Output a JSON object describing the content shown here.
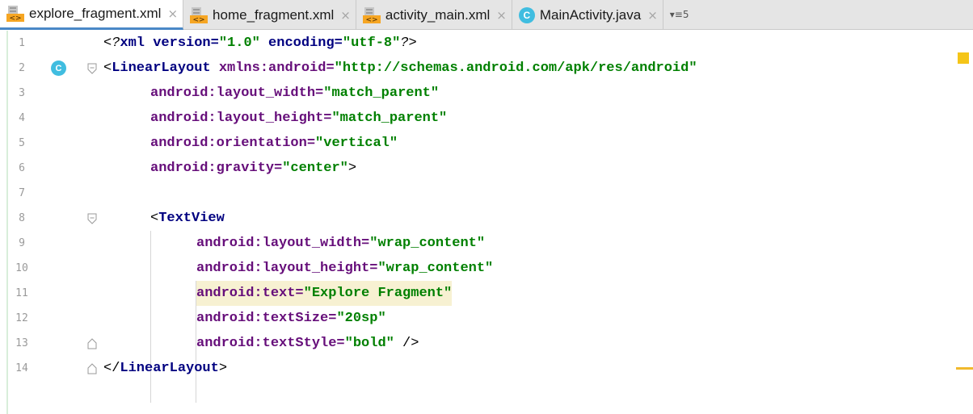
{
  "tabs": [
    {
      "label": "explore_fragment.xml",
      "icon": "xml-file-icon",
      "active": true,
      "close": "×"
    },
    {
      "label": "home_fragment.xml",
      "icon": "xml-file-icon",
      "active": false,
      "close": "×"
    },
    {
      "label": "activity_main.xml",
      "icon": "xml-file-icon",
      "active": false,
      "close": "×"
    },
    {
      "label": "MainActivity.java",
      "icon": "java-class-icon",
      "icon_letter": "C",
      "active": false,
      "close": "×"
    }
  ],
  "tab_overflow": {
    "label": "5",
    "icon": "tab-list-icon"
  },
  "gutter": {
    "class_marker_letter": "C"
  },
  "lines": [
    {
      "num": "1"
    },
    {
      "num": "2"
    },
    {
      "num": "3"
    },
    {
      "num": "4"
    },
    {
      "num": "5"
    },
    {
      "num": "6"
    },
    {
      "num": "7"
    },
    {
      "num": "8"
    },
    {
      "num": "9"
    },
    {
      "num": "10"
    },
    {
      "num": "11"
    },
    {
      "num": "12"
    },
    {
      "num": "13"
    },
    {
      "num": "14"
    }
  ],
  "code": {
    "l1": {
      "open": "<?",
      "kw1": "xml",
      "a1": " version=",
      "v1": "\"1.0\"",
      "a2": " encoding=",
      "v2": "\"utf-8\"",
      "close": "?>"
    },
    "l2": {
      "open": "<",
      "tag": "LinearLayout",
      "a1": " xmlns:android=",
      "v1": "\"http://schemas.android.com/apk/res/android\""
    },
    "l3": {
      "a": "android:layout_width=",
      "v": "\"match_parent\""
    },
    "l4": {
      "a": "android:layout_height=",
      "v": "\"match_parent\""
    },
    "l5": {
      "a": "android:orientation=",
      "v": "\"vertical\""
    },
    "l6": {
      "a": "android:gravity=",
      "v": "\"center\"",
      "close": ">"
    },
    "l8": {
      "open": "<",
      "tag": "TextView"
    },
    "l9": {
      "a": "android:layout_width=",
      "v": "\"wrap_content\""
    },
    "l10": {
      "a": "android:layout_height=",
      "v": "\"wrap_content\""
    },
    "l11": {
      "a": "android:text=",
      "v": "\"Explore Fragment\""
    },
    "l12": {
      "a": "android:textSize=",
      "v": "\"20sp\""
    },
    "l13": {
      "a": "android:textStyle=",
      "v": "\"bold\"",
      "close": " />"
    },
    "l14": {
      "open": "</",
      "tag": "LinearLayout",
      "close": ">"
    }
  },
  "colors": {
    "tag": "#000080",
    "attribute": "#660e7a",
    "string": "#008000",
    "active_tab_underline": "#4a88c7",
    "highlight": "#f7f1d2",
    "java_icon": "#40bde0",
    "warning_marker": "#f5c518"
  }
}
